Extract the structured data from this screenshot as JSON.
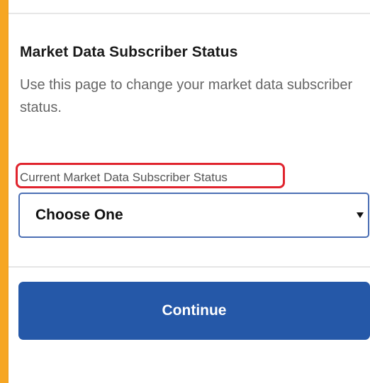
{
  "page": {
    "title": "Market Data Subscriber Status",
    "description": "Use this page to change your market data subscriber status."
  },
  "form": {
    "field_label": "Current Market Data Subscriber Status",
    "select_value": "Choose One",
    "caret_icon": "caret-down-icon"
  },
  "actions": {
    "continue_label": "Continue"
  },
  "colors": {
    "frame": "#f6a623",
    "primary": "#2558a8",
    "highlight": "#e0242e",
    "select_border": "#4b6fb4"
  }
}
